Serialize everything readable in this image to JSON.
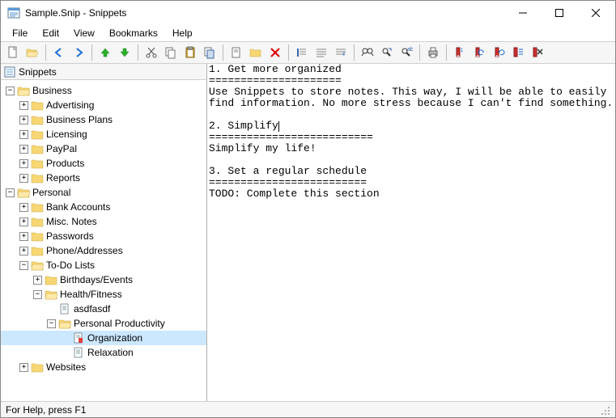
{
  "window": {
    "title": "Sample.Snip - Snippets"
  },
  "menu": {
    "file": "File",
    "edit": "Edit",
    "view": "View",
    "bookmarks": "Bookmarks",
    "help": "Help"
  },
  "tree": {
    "header": "Snippets",
    "business": "Business",
    "advertising": "Advertising",
    "business_plans": "Business Plans",
    "licensing": "Licensing",
    "paypal": "PayPal",
    "products": "Products",
    "reports": "Reports",
    "personal": "Personal",
    "bank": "Bank Accounts",
    "misc": "Misc. Notes",
    "passwords": "Passwords",
    "phone": "Phone/Addresses",
    "todo": "To-Do Lists",
    "birthdays": "Birthdays/Events",
    "health": "Health/Fitness",
    "asdf": "asdfasdf",
    "pp": "Personal Productivity",
    "org": "Organization",
    "relax": "Relaxation",
    "websites": "Websites"
  },
  "editor": {
    "text": "1. Get more organized\n=====================\nUse Snippets to store notes. This way, I will be able to easily find information. No more stress because I can't find something.\n\n2. Simplify",
    "text2": "\n==========================\nSimplify my life!\n\n3. Set a regular schedule\n=========================\nTODO: Complete this section"
  },
  "status": {
    "help": "For Help, press F1"
  }
}
